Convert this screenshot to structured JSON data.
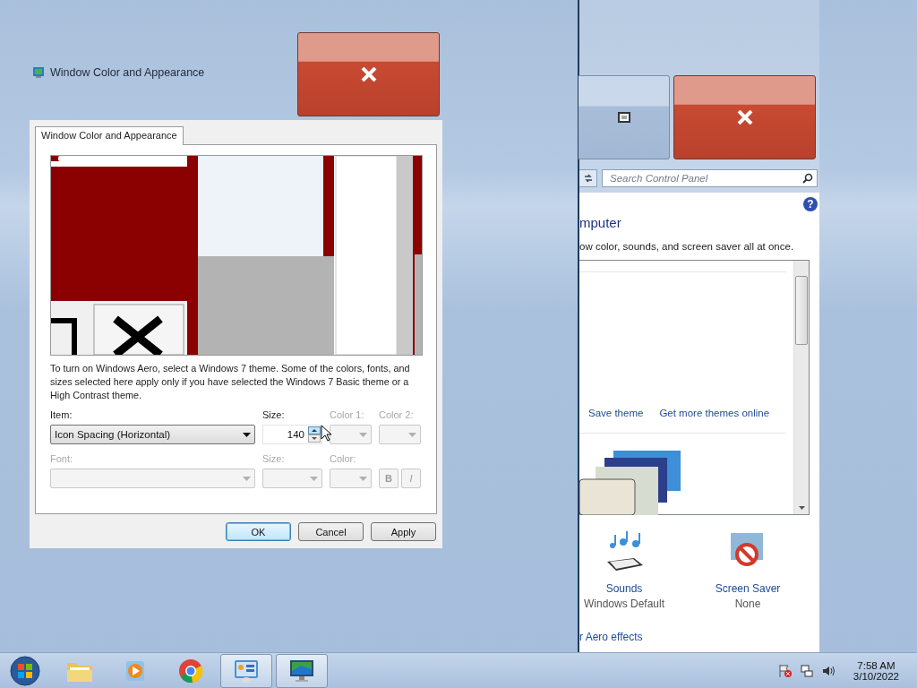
{
  "dialog": {
    "title": "Window Color and Appearance",
    "tabs": [
      {
        "label": "Window Color and Appearance",
        "selected": true
      }
    ],
    "description": "To turn on Windows Aero, select a Windows 7 theme.  Some of the colors, fonts, and sizes selected here apply only if you have selected the Windows 7 Basic theme or a High Contrast theme.",
    "row1": [
      {
        "kind": "select",
        "label": "Item:",
        "value": "Icon Spacing (Horizontal)",
        "disabled": false
      },
      {
        "kind": "spin",
        "label": "Size:",
        "value": "140",
        "disabled": false
      },
      {
        "kind": "color",
        "label": "Color 1:",
        "disabled": true
      },
      {
        "kind": "color",
        "label": "Color 2:",
        "disabled": true
      }
    ],
    "row2": [
      {
        "kind": "select",
        "label": "Font:",
        "disabled": true
      },
      {
        "kind": "select",
        "label": "Size:",
        "disabled": true
      },
      {
        "kind": "color",
        "label": "Color:",
        "disabled": true
      },
      {
        "kind": "style",
        "buttons": [
          "B",
          "I"
        ],
        "disabled": true
      }
    ],
    "buttons": [
      {
        "label": "OK",
        "default": true
      },
      {
        "label": "Cancel",
        "default": false
      },
      {
        "label": "Apply",
        "default": false
      }
    ]
  },
  "background_window": {
    "help_button": "?",
    "search": {
      "placeholder": "Search Control Panel"
    },
    "heading": "mputer",
    "description": "ow color, sounds, and screen saver all at once.",
    "links": [
      "Save theme",
      "Get more themes online"
    ],
    "items": [
      {
        "kind": "sounds",
        "title": "Sounds",
        "subtitle": "Windows Default"
      },
      {
        "kind": "screensaver",
        "title": "Screen Saver",
        "subtitle": "None"
      }
    ],
    "footer_link": "r Aero effects"
  },
  "taskbar": {
    "apps": [
      {
        "kind": "folder",
        "active": false
      },
      {
        "kind": "media",
        "active": false
      },
      {
        "kind": "browser",
        "active": false
      },
      {
        "kind": "control",
        "active": true
      },
      {
        "kind": "display",
        "active": true
      }
    ],
    "time": "7:58 AM",
    "date": "3/10/2022"
  }
}
